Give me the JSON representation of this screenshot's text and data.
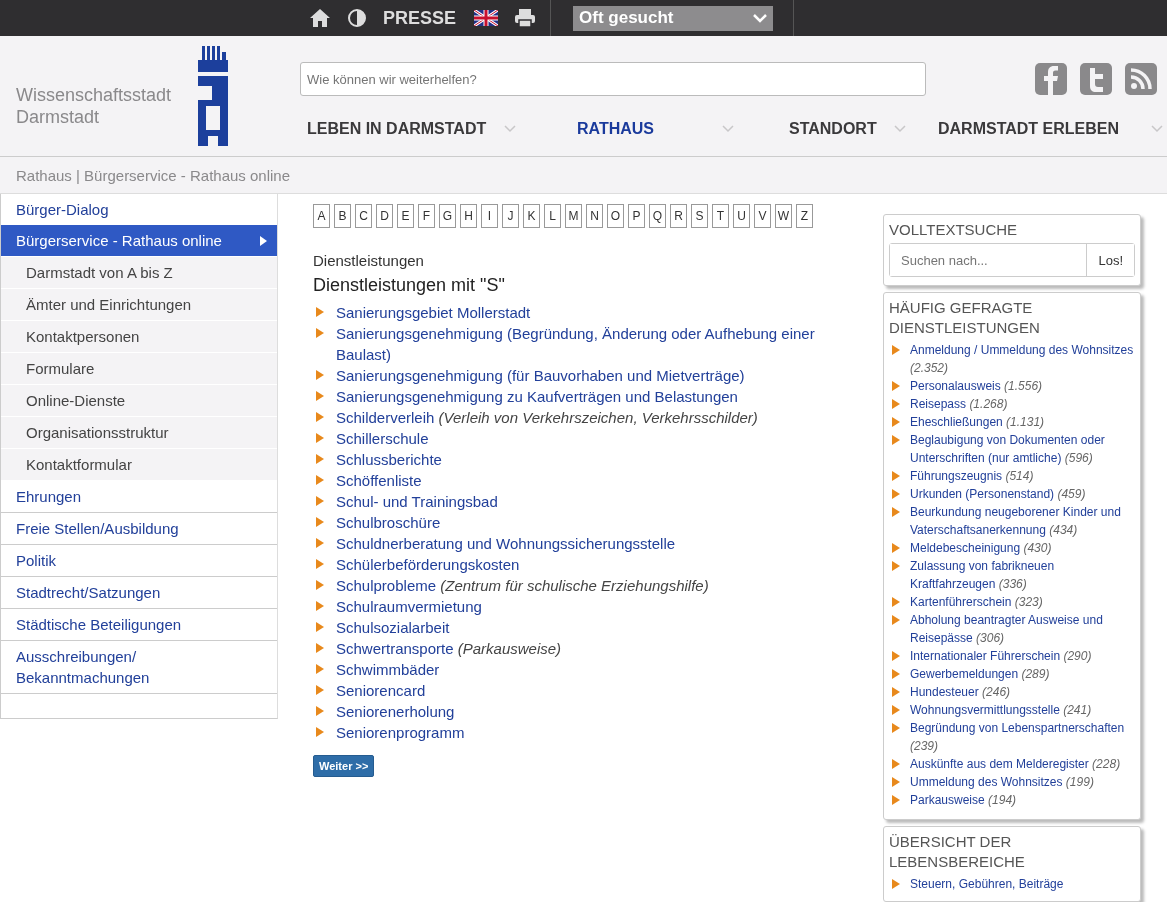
{
  "topbar": {
    "press_label": "PRESSE",
    "quick_select": "Oft gesucht"
  },
  "header": {
    "logo_text": [
      "Wissenschaftsstadt",
      "Darmstadt"
    ],
    "search": {
      "placeholder": "Wie können wir weiterhelfen?"
    },
    "nav": [
      {
        "label": "LEBEN IN DARMSTADT",
        "selected": false
      },
      {
        "label": "RATHAUS",
        "selected": true
      },
      {
        "label": "STANDORT",
        "selected": false
      },
      {
        "label": "DARMSTADT ERLEBEN",
        "selected": false
      }
    ]
  },
  "breadcrumb": "Rathaus | Bürgerservice - Rathaus online",
  "sidebar": {
    "items": [
      {
        "label": "Bürger-Dialog",
        "kind": "top",
        "selected": false
      },
      {
        "label": "Bürgerservice - Rathaus online",
        "kind": "top",
        "selected": true
      },
      {
        "label": "Darmstadt von A bis Z",
        "kind": "sub",
        "selected": false
      },
      {
        "label": "Ämter und Einrichtungen",
        "kind": "sub",
        "selected": false
      },
      {
        "label": "Kontaktpersonen",
        "kind": "sub",
        "selected": false
      },
      {
        "label": "Formulare",
        "kind": "sub",
        "selected": false
      },
      {
        "label": "Online-Dienste",
        "kind": "sub",
        "selected": false
      },
      {
        "label": "Organisationsstruktur",
        "kind": "sub",
        "selected": false
      },
      {
        "label": "Kontaktformular",
        "kind": "sub",
        "selected": false
      },
      {
        "label": "Ehrungen",
        "kind": "top",
        "selected": false
      },
      {
        "label": "Freie Stellen/Ausbildung",
        "kind": "top",
        "selected": false
      },
      {
        "label": "Politik",
        "kind": "top",
        "selected": false
      },
      {
        "label": "Stadtrecht/Satzungen",
        "kind": "top",
        "selected": false
      },
      {
        "label": "Städtische Beteiligungen",
        "kind": "top",
        "selected": false
      },
      {
        "label": "Ausschreibungen/ Bekanntmachungen",
        "kind": "top",
        "selected": false
      }
    ]
  },
  "main": {
    "letters": [
      "A",
      "B",
      "C",
      "D",
      "E",
      "F",
      "G",
      "H",
      "I",
      "J",
      "K",
      "L",
      "M",
      "N",
      "O",
      "P",
      "Q",
      "R",
      "S",
      "T",
      "U",
      "V",
      "W",
      "Z"
    ],
    "section_label": "Dienstleistungen",
    "heading": "Dienstleistungen mit \"S\"",
    "services": [
      {
        "label": "Sanierungsgebiet Mollerstadt"
      },
      {
        "label": "Sanierungsgenehmigung (Begründung, Änderung oder Aufhebung einer Baulast)"
      },
      {
        "label": "Sanierungsgenehmigung (für Bauvorhaben und Mietverträge)"
      },
      {
        "label": "Sanierungsgenehmigung zu Kaufverträgen und Belastungen"
      },
      {
        "label": "Schilderverleih",
        "note": "(Verleih von Verkehrszeichen, Verkehrsschilder)"
      },
      {
        "label": "Schillerschule"
      },
      {
        "label": "Schlussberichte"
      },
      {
        "label": "Schöffenliste"
      },
      {
        "label": "Schul- und Trainingsbad"
      },
      {
        "label": "Schulbroschüre"
      },
      {
        "label": "Schuldnerberatung und Wohnungssicherungsstelle"
      },
      {
        "label": "Schülerbeförderungskosten"
      },
      {
        "label": "Schulprobleme",
        "note": "(Zentrum für schulische Erziehungshilfe)"
      },
      {
        "label": "Schulraumvermietung"
      },
      {
        "label": "Schulsozialarbeit"
      },
      {
        "label": "Schwertransporte",
        "note": "(Parkausweise)"
      },
      {
        "label": "Schwimmbäder"
      },
      {
        "label": "Seniorencard"
      },
      {
        "label": "Seniorenerholung"
      },
      {
        "label": "Seniorenprogramm"
      }
    ],
    "next_button": "Weiter >>"
  },
  "right": {
    "search_box": {
      "title": "VOLLTEXTSUCHE",
      "placeholder": "Suchen nach...",
      "button": "Los!"
    },
    "faq": {
      "title": "HÄUFIG GEFRAGTE DIENSTLEISTUNGEN",
      "items": [
        {
          "label": "Anmeldung / Ummeldung des Wohnsitzes",
          "count": "(2.352)"
        },
        {
          "label": "Personalausweis",
          "count": "(1.556)"
        },
        {
          "label": "Reisepass",
          "count": "(1.268)"
        },
        {
          "label": "Eheschließungen",
          "count": "(1.131)"
        },
        {
          "label": "Beglaubigung von Dokumenten oder Unterschriften (nur amtliche)",
          "count": "(596)"
        },
        {
          "label": "Führungszeugnis",
          "count": "(514)"
        },
        {
          "label": "Urkunden (Personenstand)",
          "count": "(459)"
        },
        {
          "label": "Beurkundung neugeborener Kinder und Vaterschaftsanerkennung",
          "count": "(434)"
        },
        {
          "label": "Meldebescheinigung",
          "count": "(430)"
        },
        {
          "label": "Zulassung von fabrikneuen Kraftfahrzeugen",
          "count": "(336)"
        },
        {
          "label": "Kartenführerschein",
          "count": "(323)"
        },
        {
          "label": "Abholung beantragter Ausweise und Reisepässe",
          "count": "(306)"
        },
        {
          "label": "Internationaler Führerschein",
          "count": "(290)"
        },
        {
          "label": "Gewerbemeldungen",
          "count": "(289)"
        },
        {
          "label": "Hundesteuer",
          "count": "(246)"
        },
        {
          "label": "Wohnungsvermittlungsstelle",
          "count": "(241)"
        },
        {
          "label": "Begründung von Lebenspartnerschaften",
          "count": "(239)"
        },
        {
          "label": "Auskünfte aus dem Melderegister",
          "count": "(228)"
        },
        {
          "label": "Ummeldung des Wohnsitzes",
          "count": "(199)"
        },
        {
          "label": "Parkausweise",
          "count": "(194)"
        }
      ]
    },
    "areas": {
      "title": "ÜBERSICHT DER LEBENSBEREICHE",
      "items": [
        {
          "label": "Steuern, Gebühren, Beiträge"
        }
      ]
    }
  }
}
